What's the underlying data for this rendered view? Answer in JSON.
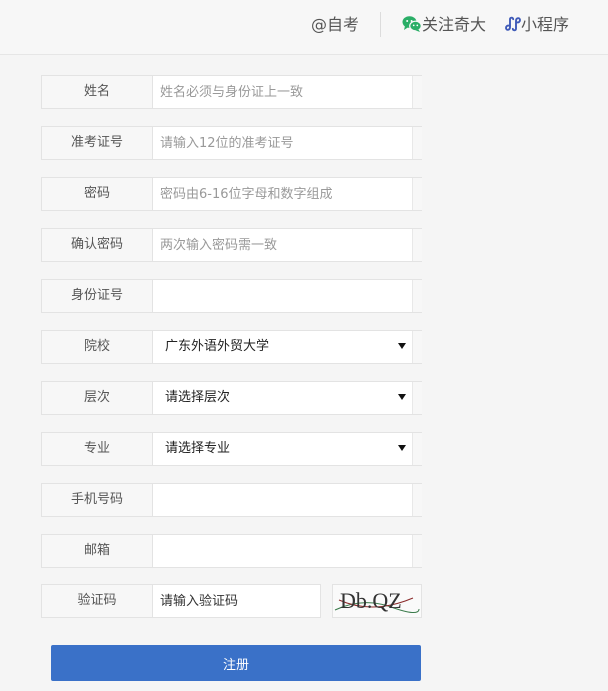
{
  "header": {
    "zikao": "@自考",
    "follow": "关注奇大",
    "miniprogram": "小程序"
  },
  "form": {
    "name": {
      "label": "姓名",
      "placeholder": "姓名必须与身份证上一致"
    },
    "ticket": {
      "label": "准考证号",
      "placeholder": "请输入12位的准考证号"
    },
    "password": {
      "label": "密码",
      "placeholder": "密码由6-16位字母和数字组成"
    },
    "confirm": {
      "label": "确认密码",
      "placeholder": "两次输入密码需一致"
    },
    "idcard": {
      "label": "身份证号",
      "placeholder": ""
    },
    "school": {
      "label": "院校",
      "value": "广东外语外贸大学"
    },
    "level": {
      "label": "层次",
      "value": "请选择层次"
    },
    "major": {
      "label": "专业",
      "value": "请选择专业"
    },
    "phone": {
      "label": "手机号码",
      "placeholder": ""
    },
    "email": {
      "label": "邮箱",
      "placeholder": ""
    },
    "captcha": {
      "label": "验证码",
      "placeholder": "请输入验证码",
      "image_text": "Db.QZ"
    },
    "submit_label": "注册"
  },
  "colors": {
    "accent": "#3a71c8",
    "wechat": "#2aae67",
    "miniprogram": "#3f5ab8"
  }
}
